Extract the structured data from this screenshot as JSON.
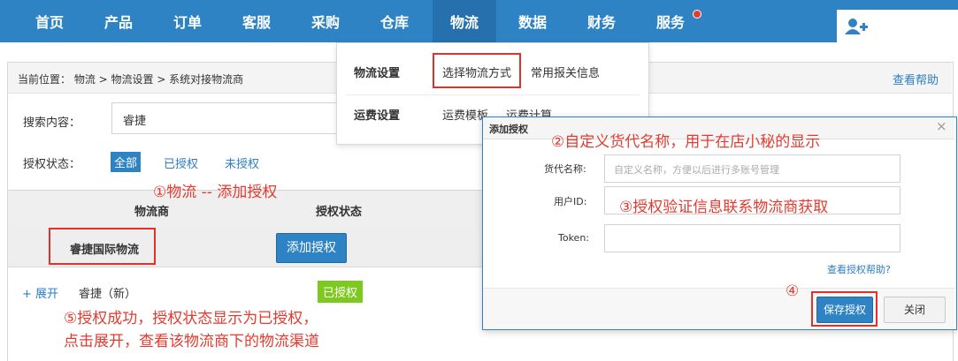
{
  "nav": {
    "items": [
      "首页",
      "产品",
      "订单",
      "客服",
      "采购",
      "仓库",
      "物流",
      "数据",
      "财务",
      "服务"
    ],
    "active_index": 6,
    "colors": {
      "bar": "#2e83c5",
      "active": "#2671ad",
      "badge": "#e63a2b"
    }
  },
  "breadcrumb": {
    "text": "当前位置： 物流 > 物流设置 > 系统对接物流商",
    "help": "查看帮助"
  },
  "search": {
    "label": "搜索内容：",
    "value": "睿捷"
  },
  "auth_filter": {
    "label": "授权状态：",
    "options": [
      "全部",
      "已授权",
      "未授权"
    ],
    "selected_index": 0
  },
  "table": {
    "headers": {
      "carrier": "物流商",
      "status": "授权状态"
    },
    "row": {
      "carrier_name": "睿捷国际物流",
      "action": "添加授权"
    },
    "sub_row": {
      "expand": "+ 展开",
      "name": "睿捷（新）",
      "status_badge": "已授权"
    }
  },
  "dropdown": {
    "group1": {
      "title": "物流设置",
      "items": [
        "选择物流方式",
        "常用报关信息"
      ]
    },
    "group2": {
      "title": "运费设置",
      "items": [
        "运费模板",
        "运费计算"
      ]
    }
  },
  "modal": {
    "title": "添加授权",
    "close": "×",
    "fields": {
      "alias_label": "货代名称:",
      "alias_placeholder": "自定义名称，方便以后进行多账号管理",
      "userid_label": "用户ID:",
      "token_label": "Token:"
    },
    "help_link": "查看授权帮助?",
    "save": "保存授权",
    "cancel": "关闭"
  },
  "annotations": {
    "a1": "①物流 -- 添加授权",
    "a2": "②自定义货代名称，用于在店小秘的显示",
    "a3": "③授权验证信息联系物流商获取",
    "a4": "④",
    "a5_line1": "⑤授权成功，授权状态显示为已授权，",
    "a5_line2": "点击展开，查看该物流商下的物流渠道"
  }
}
